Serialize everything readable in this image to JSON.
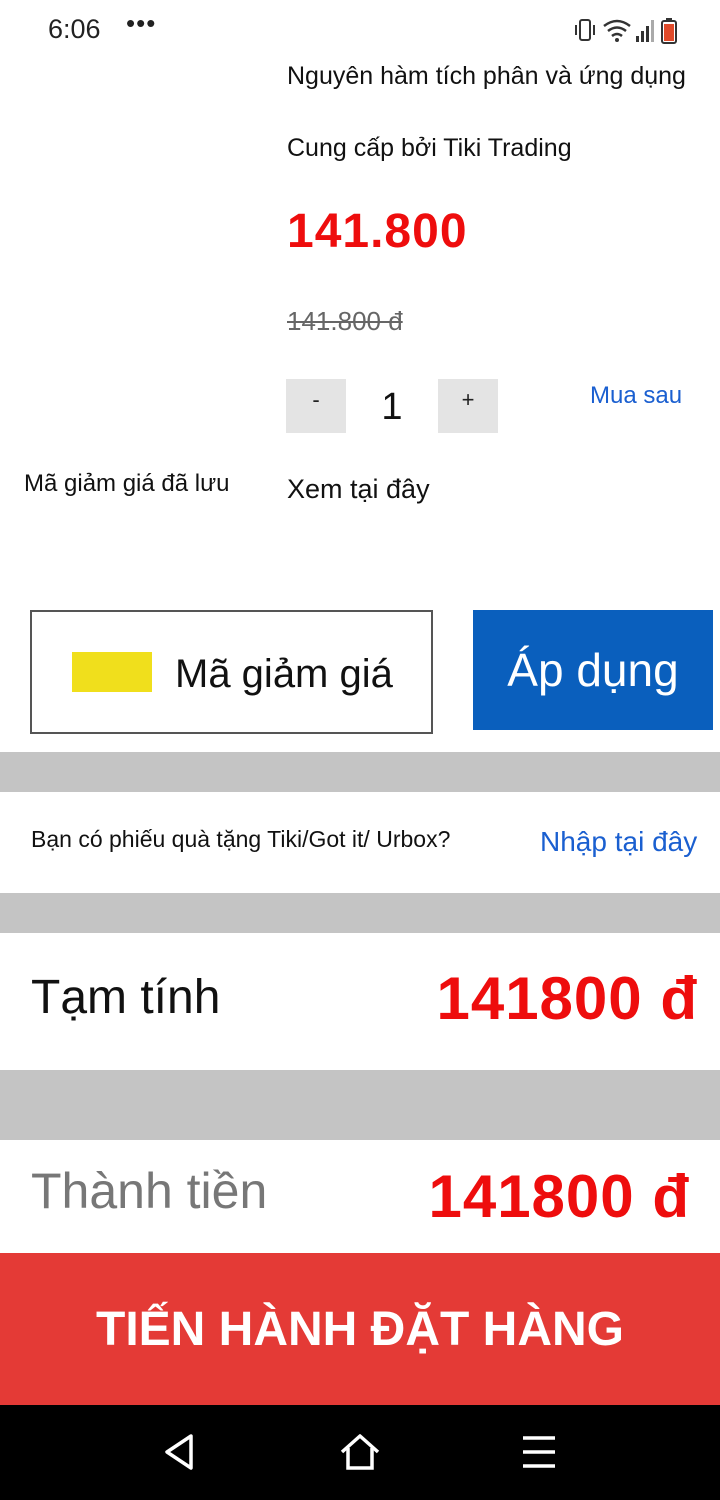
{
  "status_bar": {
    "time": "6:06",
    "dots": "•••"
  },
  "product": {
    "title": "Nguyên hàm tích phân và ứng dụng",
    "seller": "Cung cấp bởi Tiki Trading",
    "price": "141.800",
    "old_price": "141.800 đ",
    "quantity": "1",
    "minus_label": "-",
    "plus_label": "+",
    "buy_later": "Mua sau"
  },
  "saved_coupons": {
    "label": "Mã giảm giá đã lưu",
    "link": "Xem tại đây"
  },
  "coupon": {
    "placeholder": "Mã giảm giá",
    "apply_label": "Áp dụng"
  },
  "gift": {
    "question": "Bạn có phiếu quà tặng Tiki/Got it/ Urbox?",
    "link": "Nhập tại đây"
  },
  "summary": {
    "subtotal_label": "Tạm tính",
    "subtotal_value": "141800 đ",
    "total_label": "Thành tiền",
    "total_value": "141800 đ"
  },
  "checkout": {
    "label": "TIẾN HÀNH ĐẶT HÀNG"
  },
  "colors": {
    "price_red": "#ee0d0d",
    "apply_blue": "#0a5fbd",
    "checkout_red": "#e43a36",
    "link_blue": "#1a5fd0",
    "coupon_yellow": "#f0df1c"
  },
  "icons": {
    "status": [
      "vibrate-icon",
      "wifi-icon",
      "signal-icon",
      "battery-icon"
    ],
    "nav": [
      "back-icon",
      "home-icon",
      "menu-icon"
    ]
  }
}
